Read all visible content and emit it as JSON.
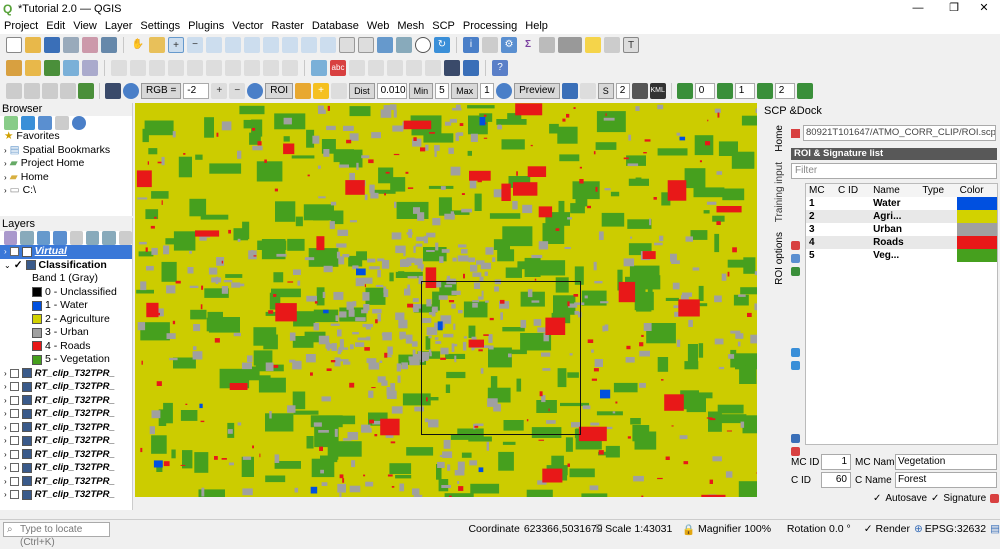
{
  "window": {
    "title": "*Tutorial 2.0 — QGIS"
  },
  "menu": [
    "Project",
    "Edit",
    "View",
    "Layer",
    "Settings",
    "Plugins",
    "Vector",
    "Raster",
    "Database",
    "Web",
    "Mesh",
    "SCP",
    "Processing",
    "Help"
  ],
  "scp_toolbar": {
    "rgb_label": "RGB =",
    "rgb_value": "-2",
    "roi_label": "ROI",
    "dist_label": "Dist",
    "dist_value": "0.010",
    "min_label": "Min",
    "min_value": "5",
    "max_label": "Max",
    "max_value": "1",
    "preview_label": "Preview",
    "s_label": "S",
    "s_value": "2",
    "kml_label": "KML",
    "spin1": "0",
    "spin2": "1",
    "spin3": "2"
  },
  "browser": {
    "title": "Browser",
    "items": [
      "Favorites",
      "Spatial Bookmarks",
      "Project Home",
      "Home",
      "C:\\"
    ]
  },
  "layers": {
    "title": "Layers",
    "virtual": "Virtual",
    "classification": "Classification",
    "band": "Band 1 (Gray)",
    "classes": [
      {
        "label": "0 - Unclassified",
        "color": "#000000"
      },
      {
        "label": "1 - Water",
        "color": "#0050e0"
      },
      {
        "label": "2 - Agriculture",
        "color": "#d2d200"
      },
      {
        "label": "3 - Urban",
        "color": "#a0a0a0"
      },
      {
        "label": "4 - Roads",
        "color": "#e81818"
      },
      {
        "label": "5 - Vegetation",
        "color": "#46a01e"
      }
    ],
    "rt_items": [
      "RT_clip_T32TPR_",
      "RT_clip_T32TPR_",
      "RT_clip_T32TPR_",
      "RT_clip_T32TPR_",
      "RT_clip_T32TPR_",
      "RT_clip_T32TPR_",
      "RT_clip_T32TPR_",
      "RT_clip_T32TPR_",
      "RT_clip_T32TPR_",
      "RT_clip_T32TPR_"
    ]
  },
  "scp": {
    "dock_title": "SCP &Dock",
    "tabs": [
      "Home",
      "Training input",
      "ROI options"
    ],
    "path": "80921T101647/ATMO_CORR_CLIP/ROI.scp",
    "list_title": "ROI & Signature list",
    "filter_placeholder": "Filter",
    "headers": [
      "MC",
      "C ID",
      "Name",
      "Type",
      "Color"
    ],
    "rows": [
      {
        "mc": "1",
        "name": "Water",
        "color": "#0050e0"
      },
      {
        "mc": "2",
        "name": "Agri...",
        "color": "#d2d200"
      },
      {
        "mc": "3",
        "name": "Urban",
        "color": "#a0a0a0"
      },
      {
        "mc": "4",
        "name": "Roads",
        "color": "#e81818"
      },
      {
        "mc": "5",
        "name": "Veg...",
        "color": "#46a01e"
      }
    ],
    "mc_id_label": "MC ID",
    "mc_id_value": "1",
    "mc_name_label": "MC Name",
    "mc_name_value": "Vegetation",
    "c_id_label": "C ID",
    "c_id_value": "60",
    "c_name_label": "C Name",
    "c_name_value": "Forest",
    "autosave": "Autosave",
    "signature": "Signature"
  },
  "status": {
    "locate_placeholder": "Type to locate (Ctrl+K)",
    "coordinate_label": "Coordinate",
    "coordinate_value": "623366,5031679",
    "scale_label": "Scale",
    "scale_value": "1:43031",
    "magnifier_label": "Magnifier",
    "magnifier_value": "100%",
    "rotation_label": "Rotation",
    "rotation_value": "0.0 °",
    "render_label": "Render",
    "epsg": "EPSG:32632"
  },
  "colors": {
    "agriculture": "#cccc00",
    "vegetation": "#46a01e",
    "urban": "#a0a0a0",
    "roads": "#e81818",
    "water": "#0050e0"
  }
}
